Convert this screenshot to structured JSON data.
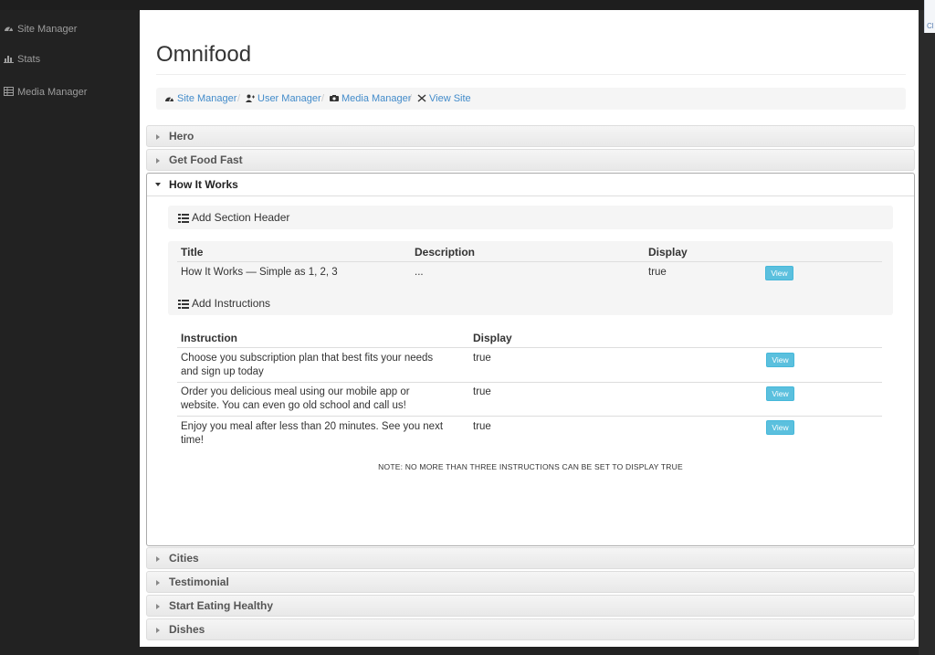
{
  "sidebar": {
    "items": [
      {
        "label": "Site Manager",
        "icon": "dashboard-icon"
      },
      {
        "label": "Stats",
        "icon": "bar-chart-icon"
      },
      {
        "label": "Media Manager",
        "icon": "table-icon"
      }
    ]
  },
  "corner_text": "Cl",
  "page": {
    "title": "Omnifood"
  },
  "breadcrumb": [
    {
      "label": "Site Manager",
      "icon": "dashboard-icon"
    },
    {
      "label": "User Manager",
      "icon": "user-plus-icon"
    },
    {
      "label": "Media Manager",
      "icon": "camera-icon"
    },
    {
      "label": "View Site",
      "icon": "tools-icon"
    }
  ],
  "breadcrumb_separator": "/",
  "sections": {
    "hero": "Hero",
    "get_food_fast": "Get Food Fast",
    "how_it_works": "How It Works",
    "cities": "Cities",
    "testimonial": "Testimonial",
    "start_eating_healthy": "Start Eating Healthy",
    "dishes": "Dishes"
  },
  "how_it_works": {
    "add_section_header_label": "Add Section Header",
    "header_table": {
      "columns": [
        "Title",
        "Description",
        "Display"
      ],
      "row": {
        "title": "How It Works — Simple as 1, 2, 3",
        "description": "...",
        "display": "true",
        "action": "View"
      }
    },
    "add_instructions_label": "Add Instructions",
    "instructions_table": {
      "columns": [
        "Instruction",
        "Display"
      ],
      "rows": [
        {
          "instruction_line1": "Choose you subscription plan that best fits your needs",
          "instruction_line2": "and sign up today",
          "display": "true",
          "action": "View"
        },
        {
          "instruction_line1": "Order you delicious meal using our mobile app or",
          "instruction_line2": "website. You can even go old school and call us!",
          "display": "true",
          "action": "View"
        },
        {
          "instruction_line1": "Enjoy you meal after less than 20 minutes. See you next",
          "instruction_line2": "time!",
          "display": "true",
          "action": "View"
        }
      ]
    },
    "note": "NOTE: NO MORE THAN THREE INSTRUCTIONS CAN BE SET TO DISPLAY TRUE"
  }
}
